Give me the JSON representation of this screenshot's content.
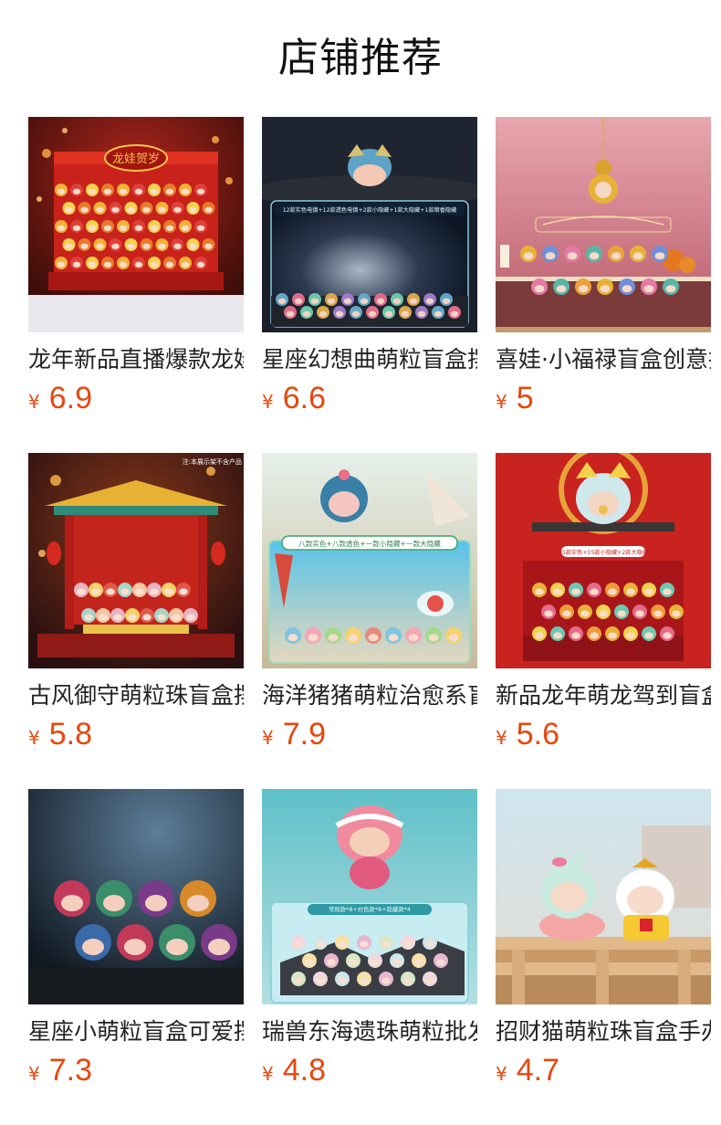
{
  "section_title": "店铺推荐",
  "currency_symbol": "¥",
  "products": [
    {
      "name": "龙年新品直播爆款龙娃",
      "price": "6.9",
      "image_text": "龙娃贺岁",
      "image_icon": "dragon-blindbox-stage-image"
    },
    {
      "name": "星座幻想曲萌粒盲盒摆件",
      "price": "6.6",
      "image_text": "12款实色电镀+12款透色电镀+2款小隐藏+1款大隐藏+1款暗香隐藏",
      "image_icon": "zodiac-fantasy-image"
    },
    {
      "name": "喜娃·小福禄盲盒创意摆件",
      "price": "5",
      "image_text": "",
      "image_icon": "gourd-blessing-image"
    },
    {
      "name": "古风御守萌粒珠盲盒摆件",
      "price": "5.8",
      "image_text": "注:本展示架不含产品",
      "image_icon": "ancient-pavilion-image"
    },
    {
      "name": "海洋猪猪萌粒治愈系盲盒",
      "price": "7.9",
      "image_text": "八款实色+八款透色+一款小隐藏+一款大隐藏",
      "image_icon": "ocean-piggy-image"
    },
    {
      "name": "新品龙年萌龙驾到盲盒",
      "price": "5.6",
      "image_text": "15款实色+15款小隐藏+2款大隐藏",
      "image_icon": "lion-dance-dragon-image"
    },
    {
      "name": "星座小萌粒盲盒可爱摆件",
      "price": "7.3",
      "image_text": "",
      "image_icon": "zodiac-cute-figures-image"
    },
    {
      "name": "瑞兽东海遗珠萌粒批发",
      "price": "4.8",
      "image_text": "常规款*8+炒色款*8+隐藏款*4",
      "image_icon": "auspicious-beast-image"
    },
    {
      "name": "招财猫萌粒珠盲盒手办",
      "price": "4.7",
      "image_text": "",
      "image_icon": "lucky-cat-image"
    }
  ],
  "colors": {
    "title": "#111111",
    "price": "#e8470e",
    "name": "#222222",
    "background": "#ffffff"
  }
}
